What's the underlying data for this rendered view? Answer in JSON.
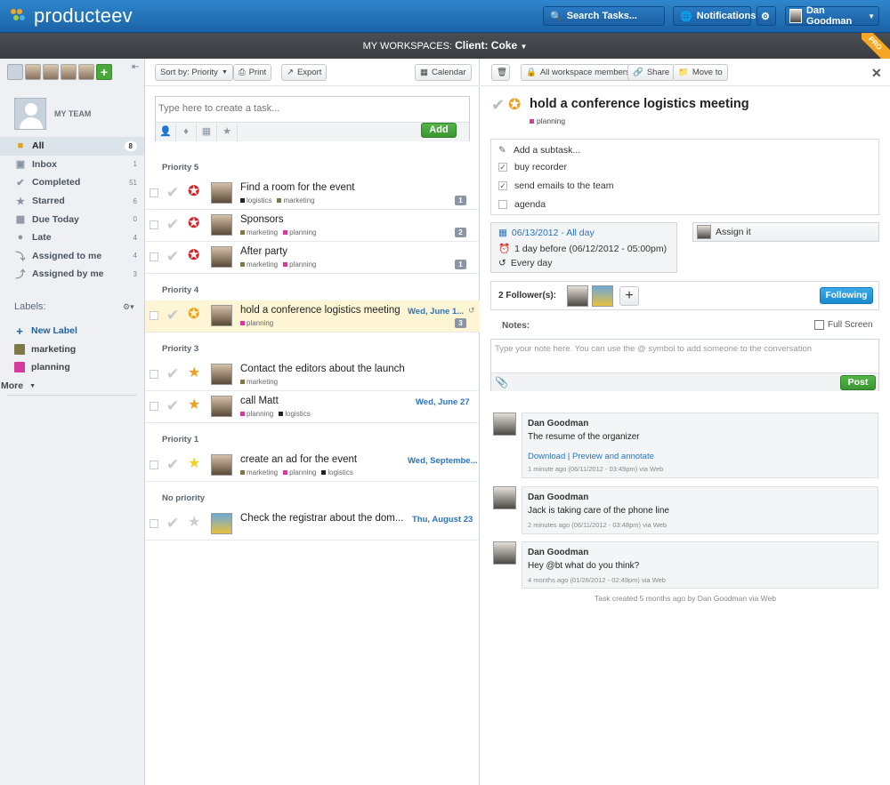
{
  "app": {
    "name": "producteev"
  },
  "topbar": {
    "search_label": "Search Tasks...",
    "notifications_label": "Notifications",
    "user_name": "Dan Goodman"
  },
  "workspace": {
    "prefix": "MY WORKSPACES:",
    "name": "Client: Coke",
    "pro_badge": "PRO"
  },
  "sidebar": {
    "my_team": "MY TEAM",
    "nav": [
      {
        "label": "All",
        "count": "8",
        "icon": "folder-icon"
      },
      {
        "label": "Inbox",
        "count": "1",
        "icon": "inbox-icon"
      },
      {
        "label": "Completed",
        "count": "51",
        "icon": "check-icon"
      },
      {
        "label": "Starred",
        "count": "6",
        "icon": "star-icon"
      },
      {
        "label": "Due Today",
        "count": "0",
        "icon": "calendar-icon"
      },
      {
        "label": "Late",
        "count": "4",
        "icon": "alert-icon"
      },
      {
        "label": "Assigned to me",
        "count": "4",
        "icon": "arrow-in-icon"
      },
      {
        "label": "Assigned by me",
        "count": "3",
        "icon": "arrow-out-icon"
      }
    ],
    "labels_heading": "Labels:",
    "new_label": "New Label",
    "labels": [
      {
        "name": "marketing",
        "color": "#7d7a48"
      },
      {
        "name": "planning",
        "color": "#d43c9c"
      }
    ],
    "more": "More"
  },
  "toolbar": {
    "sort": "Sort by: Priority",
    "print": "Print",
    "export": "Export",
    "calendar": "Calendar"
  },
  "new_task": {
    "placeholder": "Type here to create a task...",
    "add": "Add"
  },
  "groups": {
    "p5": "Priority 5",
    "p4": "Priority 4",
    "p3": "Priority 3",
    "p1": "Priority 1",
    "none": "No priority"
  },
  "tasks": [
    {
      "title": "Find a room for the event",
      "tags": [
        "logistics",
        "marketing"
      ],
      "date": "",
      "comments": "1"
    },
    {
      "title": "Sponsors",
      "tags": [
        "marketing",
        "planning"
      ],
      "date": "",
      "comments": "2"
    },
    {
      "title": "After party",
      "tags": [
        "marketing",
        "planning"
      ],
      "date": "",
      "comments": "1"
    },
    {
      "title": "hold a conference logistics meeting",
      "tags": [
        "planning"
      ],
      "date": "Wed, June 1...",
      "comments": "3"
    },
    {
      "title": "Contact the editors about the launch",
      "tags": [
        "marketing"
      ],
      "date": "",
      "comments": ""
    },
    {
      "title": "call Matt",
      "tags": [
        "planning",
        "logistics"
      ],
      "date": "Wed, June 27",
      "comments": ""
    },
    {
      "title": "create an ad for the event",
      "tags": [
        "marketing",
        "planning",
        "logistics"
      ],
      "date": "Wed, Septembe...",
      "comments": ""
    },
    {
      "title": "Check the registrar about the dom...",
      "tags": [],
      "date": "Thu, August 23",
      "comments": ""
    }
  ],
  "tag_colors": {
    "logistics": "#222222",
    "marketing": "#7d7a48",
    "planning": "#d43c9c"
  },
  "detail": {
    "delete": "",
    "members": "All workspace members",
    "share": "Share",
    "move": "Move to",
    "title": "hold a conference logistics meeting",
    "tag": "planning",
    "add_subtask": "Add a subtask...",
    "subtasks": [
      {
        "label": "buy recorder",
        "done": "✓"
      },
      {
        "label": "send emails to the team",
        "done": "✓"
      },
      {
        "label": "agenda",
        "done": ""
      }
    ],
    "due": "06/13/2012 - All day",
    "reminder": "1 day before (06/12/2012 - 05:00pm)",
    "repeat": "Every day",
    "assign": "Assign it",
    "followers_label": "2 Follower(s):",
    "following": "Following",
    "notes_label": "Notes:",
    "fullscreen": "Full Screen",
    "note_placeholder": "Type your note here. You can use the @ symbol to add someone to the conversation",
    "post": "Post",
    "comments": [
      {
        "author": "Dan Goodman",
        "text": "The resume of the organizer",
        "link": "Download | Preview and annotate",
        "meta": "1 minute ago (06/11/2012 - 03:49pm) via Web"
      },
      {
        "author": "Dan Goodman",
        "text": "Jack is taking care of the phone line",
        "link": "",
        "meta": "2 minutes ago (06/11/2012 - 03:48pm) via Web"
      },
      {
        "author": "Dan Goodman",
        "text": "Hey @bt what do you think?",
        "link": "",
        "meta": "4 months ago (01/26/2012 - 02:49pm) via Web"
      }
    ],
    "created": "Task created 5 months ago by Dan Goodman via Web"
  }
}
